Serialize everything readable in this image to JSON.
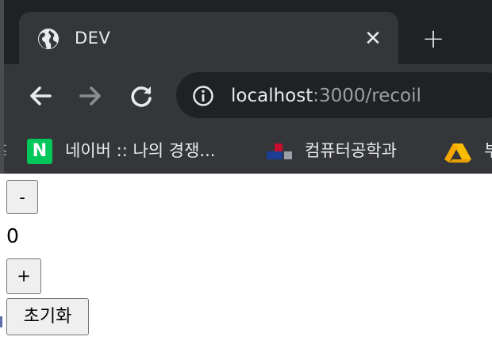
{
  "browser": {
    "tab": {
      "title": "DEV",
      "icon": "globe-icon",
      "close_label": "✕"
    },
    "new_tab_label": "+",
    "nav": {
      "back_icon": "back-arrow-icon",
      "forward_icon": "forward-arrow-icon",
      "reload_icon": "reload-icon"
    },
    "address_bar": {
      "host": "localhost",
      "path": ":3000/recoil",
      "icon": "info-icon"
    },
    "bookmarks": [
      {
        "label": "네이버 :: 나의 경쟁...",
        "icon": "naver-icon"
      },
      {
        "label": "컴퓨터공학과",
        "icon": "department-icon"
      },
      {
        "label": "부",
        "icon": "drive-icon"
      }
    ],
    "colors": {
      "frame": "#202124",
      "toolbar": "#35363a",
      "text": "#e8eaed",
      "muted": "#9aa0a6"
    }
  },
  "page": {
    "decrement_label": "-",
    "count": "0",
    "increment_label": "+",
    "reset_label": "초기화"
  }
}
